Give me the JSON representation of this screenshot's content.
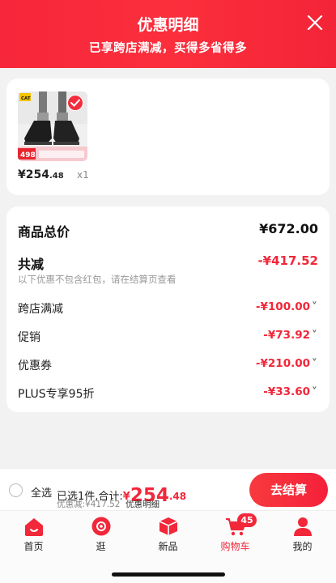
{
  "header": {
    "title": "优惠明细",
    "subtitle": "已享跨店满减，买得多省得多"
  },
  "product": {
    "brand_tag": "CAT",
    "tag_price": "498",
    "price_int": "¥254",
    "price_dec": ".48",
    "quantity": "x1"
  },
  "summary": {
    "total_label": "商品总价",
    "total_value": "¥672.00",
    "discount_label": "共减",
    "discount_value": "-¥417.52",
    "note": "以下优惠不包含红包，请在结算页查看",
    "items": [
      {
        "label": "跨店满减",
        "value": "-¥100.00"
      },
      {
        "label": "促销",
        "value": "-¥73.92"
      },
      {
        "label": "优惠券",
        "value": "-¥210.00"
      },
      {
        "label": "PLUS专享95折",
        "value": "-¥33.60"
      }
    ]
  },
  "checkout_bar": {
    "select_all": "全选",
    "selected_prefix": "已选1件,合计:",
    "currency": "¥",
    "total_int": "254",
    "total_dec": ".48",
    "discount_text": "优惠减:¥417.52",
    "detail_link": "优惠明细",
    "checkout_button": "去结算"
  },
  "tabs": [
    {
      "label": "首页",
      "icon": "home-icon"
    },
    {
      "label": "逛",
      "icon": "explore-icon"
    },
    {
      "label": "新品",
      "icon": "new-product-icon"
    },
    {
      "label": "购物车",
      "icon": "cart-icon",
      "badge": "45",
      "active": true
    },
    {
      "label": "我的",
      "icon": "profile-icon"
    }
  ],
  "colors": {
    "brand_red": "#f2273a",
    "header_red": "#fb2f3c"
  }
}
